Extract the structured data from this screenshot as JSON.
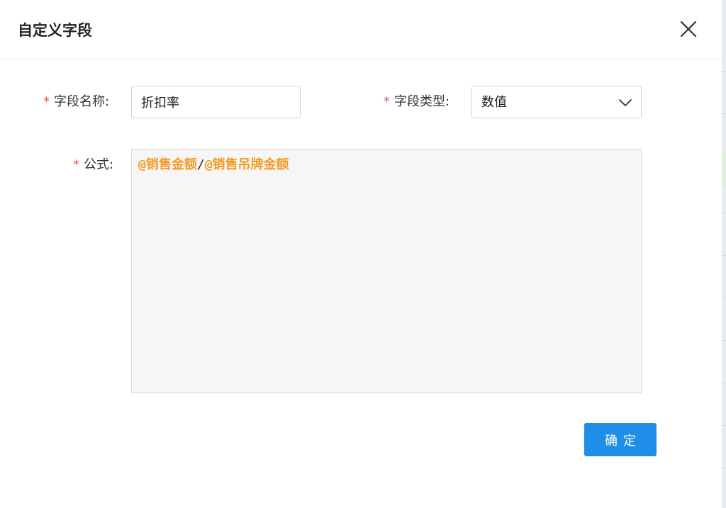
{
  "dialog": {
    "title": "自定义字段",
    "close_icon": "close-icon"
  },
  "form": {
    "required_mark": "*",
    "field_name": {
      "label": "字段名称:",
      "value": "折扣率"
    },
    "field_type": {
      "label": "字段类型:",
      "selected": "数值",
      "dropdown_icon": "chevron-down-icon"
    },
    "formula": {
      "label": "公式:",
      "tokens": [
        {
          "kind": "field",
          "text": "@销售金额"
        },
        {
          "kind": "operator",
          "text": "/"
        },
        {
          "kind": "field",
          "text": "@销售吊牌金额"
        }
      ]
    }
  },
  "footer": {
    "confirm_label": "确定"
  },
  "colors": {
    "accent": "#1e8ee8",
    "required": "#ef5350",
    "formula_token": "#f59a23",
    "formula_background": "#f6f6f6"
  }
}
